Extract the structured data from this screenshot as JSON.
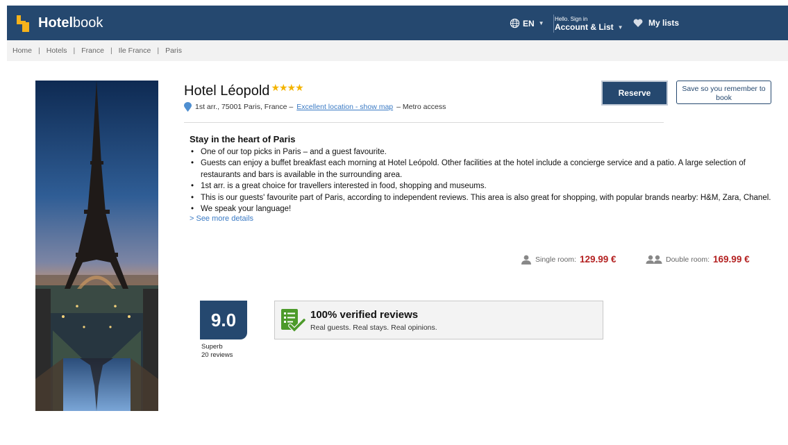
{
  "header": {
    "brand_bold": "Hotel",
    "brand_rest": "book",
    "language": "EN",
    "greeting": "Hello. Sign in",
    "account_label": "Account & List",
    "my_lists": "My lists"
  },
  "breadcrumb": [
    "Home",
    "Hotels",
    "France",
    "Ile France",
    "Paris"
  ],
  "hotel": {
    "name": "Hotel Léopold",
    "stars": "★★★★",
    "address": "1st arr., 75001 Paris, France –",
    "map_link": "Excellent location - show map",
    "address_suffix": "– Metro access"
  },
  "actions": {
    "reserve": "Reserve",
    "save": "Save so you remember to book"
  },
  "description": {
    "heading": "Stay in the heart of Paris",
    "bullets": [
      "One of our top picks in Paris – and a guest favourite.",
      "Guests can enjoy a buffet breakfast each morning at Hotel Leópold. Other facilities at the hotel include a concierge service and a patio. A large selection of restaurants and bars is available in the surrounding area.",
      "1st arr. is a great choice for travellers interested in food, shopping and museums.",
      "This is our guests' favourite part of Paris, according to independent reviews. This area is also great for shopping, with popular brands nearby: H&M, Zara, Chanel.",
      "We speak your language!"
    ],
    "more": "> See more details"
  },
  "prices": {
    "single_label": "Single room:",
    "single_price": "129.99 €",
    "double_label": "Double room:",
    "double_price": "169.99 €"
  },
  "rating": {
    "score": "9.0",
    "label": "Superb",
    "reviews": "20 reviews"
  },
  "verified": {
    "title": "100% verified reviews",
    "subtitle": "Real guests. Real stays. Real opinions."
  },
  "colors": {
    "brand_navy": "#25486f",
    "logo_yellow": "#f5b21b",
    "star_gold": "#f4b400",
    "price_red": "#b42222",
    "link_blue": "#3a7ac4",
    "check_green": "#4c9a2a"
  }
}
